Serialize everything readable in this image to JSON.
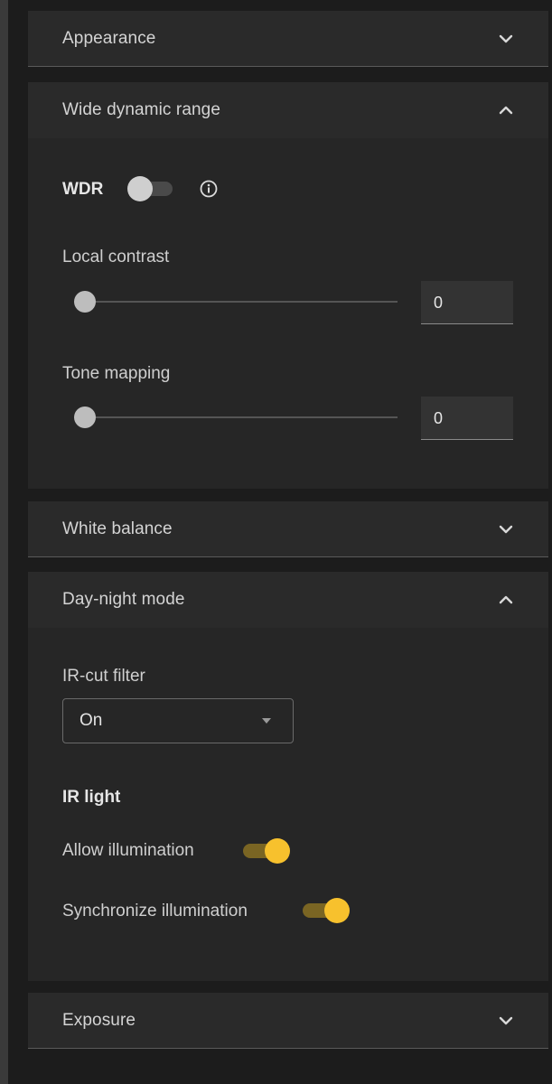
{
  "sections": {
    "appearance": {
      "title": "Appearance",
      "expanded": false
    },
    "wdr": {
      "title": "Wide dynamic range",
      "expanded": true,
      "wdr_label": "WDR",
      "wdr_enabled": false,
      "local_contrast": {
        "label": "Local contrast",
        "value": "0"
      },
      "tone_mapping": {
        "label": "Tone mapping",
        "value": "0"
      }
    },
    "white_balance": {
      "title": "White balance",
      "expanded": false
    },
    "day_night": {
      "title": "Day-night mode",
      "expanded": true,
      "ir_cut_filter": {
        "label": "IR-cut filter",
        "selected": "On"
      },
      "ir_light_heading": "IR light",
      "allow_illumination": {
        "label": "Allow illumination",
        "enabled": true
      },
      "synchronize_illumination": {
        "label": "Synchronize illumination",
        "enabled": true
      }
    },
    "exposure": {
      "title": "Exposure",
      "expanded": false
    }
  },
  "colors": {
    "accent": "#f7c12d",
    "accent_track": "#7a6523",
    "panel": "#262626",
    "header": "#2a2a2a",
    "background": "#1c1c1c"
  }
}
